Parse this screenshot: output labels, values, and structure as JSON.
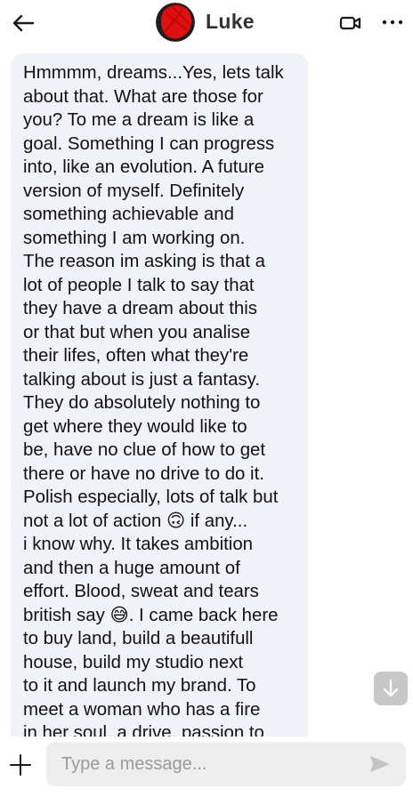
{
  "header": {
    "back_icon": "arrow-left-icon",
    "contact_name": "Luke",
    "video_icon": "video-camera-icon",
    "more_icon": "ellipsis-icon",
    "avatar_redaction_color": "#e01010"
  },
  "messages": [
    {
      "direction": "incoming",
      "text": "Hmmmm, dreams...Yes, lets talk\nabout that. What are those for\nyou? To me a dream is like a\ngoal. Something I can progress\ninto, like an evolution. A future\nversion of myself. Definitely\nsomething achievable and\nsomething I am working on.\nThe reason im asking is that a\nlot of people I talk to say that\nthey have a dream about this\nor that but when you analise\ntheir lifes, often what they're\ntalking about is just a fantasy.\nThey do absolutely nothing to\nget where they would like to\nbe, have no clue of how to get\nthere or have no drive to do it.\nPolish especially, lots of talk but\nnot a lot of action 🙃 if any...\ni know why. It takes ambition\nand then a huge amount of\neffort. Blood, sweat and tears\nbritish say 😅. I came back here\nto buy land, build a beautifull\nhouse, build my studio next\nto it and launch my brand. To\nmeet a woman who has a fire\nin her soul, a drive, passion to"
    }
  ],
  "scroll_down_icon": "arrow-down-icon",
  "composer": {
    "add_icon": "plus-icon",
    "placeholder": "Type a message...",
    "value": "",
    "send_icon": "send-icon"
  },
  "colors": {
    "bubble_bg": "#f1f1f8",
    "input_bg": "#eeeeee",
    "send_icon": "#c4c4c4",
    "scroll_button_bg": "#c8c8c8"
  }
}
